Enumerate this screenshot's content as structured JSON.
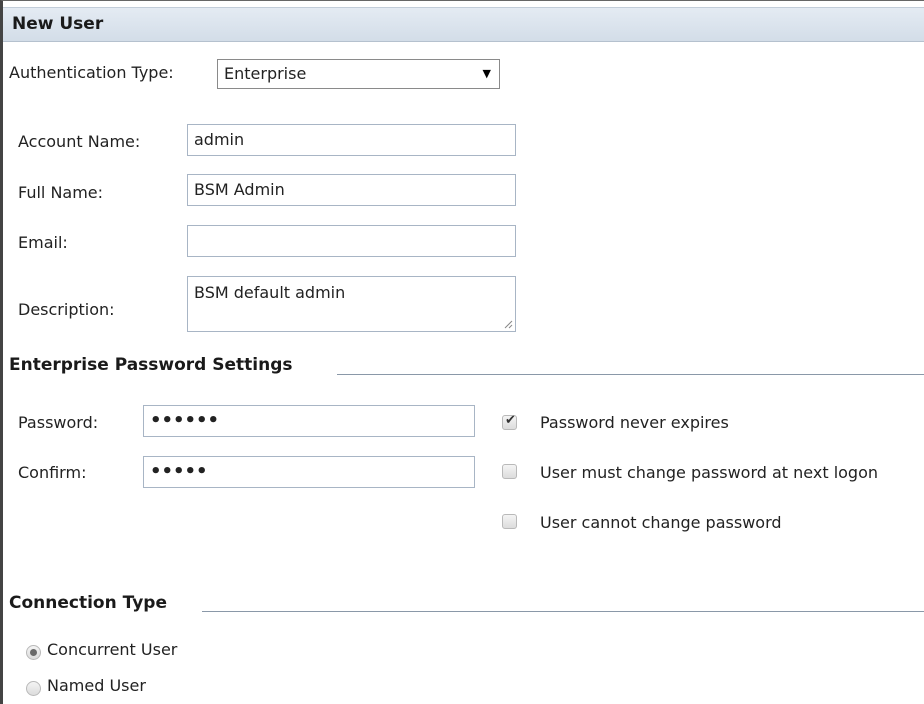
{
  "dialog": {
    "title": "New User"
  },
  "authentication": {
    "label": "Authentication Type:",
    "selected": "Enterprise"
  },
  "account": {
    "account_name_label": "Account Name:",
    "account_name_value": "admin",
    "full_name_label": "Full Name:",
    "full_name_value": "BSM Admin",
    "email_label": "Email:",
    "email_value": "",
    "description_label": "Description:",
    "description_value": "BSM default admin"
  },
  "password_settings": {
    "section_title": "Enterprise Password Settings",
    "password_label": "Password:",
    "password_mask": "••••••",
    "confirm_label": "Confirm:",
    "confirm_mask": "•••••",
    "options": [
      {
        "label": "Password never expires",
        "checked": true
      },
      {
        "label": "User must change password at next logon",
        "checked": false
      },
      {
        "label": "User cannot change password",
        "checked": false
      }
    ]
  },
  "connection": {
    "section_title": "Connection Type",
    "options": [
      {
        "label": "Concurrent User",
        "selected": true
      },
      {
        "label": "Named User",
        "selected": false
      }
    ]
  },
  "icons": {
    "dropdown": "triangle-down",
    "checkbox_checked": "checkmark",
    "resize": "resize-grip"
  }
}
